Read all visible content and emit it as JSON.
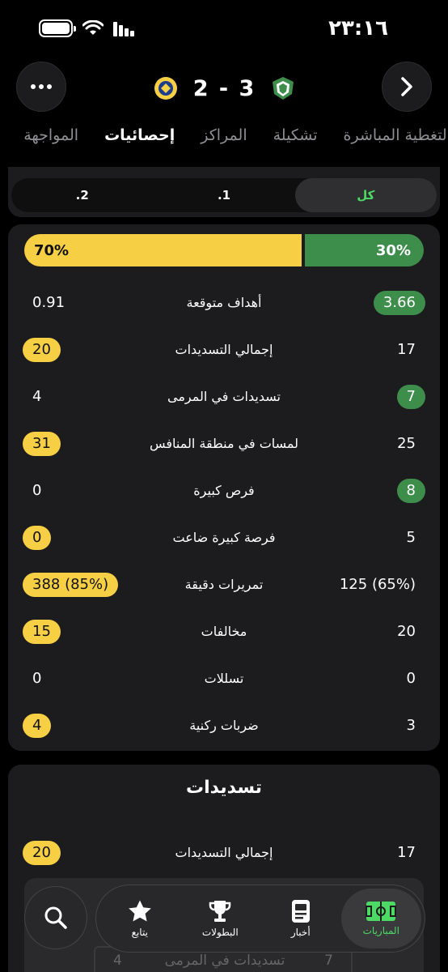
{
  "status": {
    "time": "٢٣:١٦"
  },
  "header": {
    "score": "2 - 3",
    "home_team_color": "#3e8e4b",
    "away_team_color": "#f6cf44"
  },
  "tabs": [
    "التغطية المباشرة",
    "تشكيلة",
    "المراكز",
    "إحصائيات",
    "المواجهة"
  ],
  "active_tab": "إحصائيات",
  "filter": {
    "options": [
      "كل",
      "1.",
      "2."
    ],
    "selected": "كل"
  },
  "possession": {
    "home": "30%",
    "away": "70%",
    "home_fraction": 0.3,
    "away_fraction": 0.7
  },
  "stats": [
    {
      "label": "أهداف متوقعة",
      "home": "3.66",
      "away": "0.91",
      "highlight": "home"
    },
    {
      "label": "إجمالي التسديدات",
      "home": "17",
      "away": "20",
      "highlight": "away"
    },
    {
      "label": "تسديدات في المرمى",
      "home": "7",
      "away": "4",
      "highlight": "home"
    },
    {
      "label": "لمسات في منطقة المنافس",
      "home": "25",
      "away": "31",
      "highlight": "away"
    },
    {
      "label": "فرص كبيرة",
      "home": "8",
      "away": "0",
      "highlight": "home"
    },
    {
      "label": "فرصة كبيرة ضاعت",
      "home": "5",
      "away": "0",
      "highlight": "away"
    },
    {
      "label": "تمريرات دقيقة",
      "home": "125 (65%)",
      "away": "388 (85%)",
      "highlight": "away"
    },
    {
      "label": "مخالفات",
      "home": "20",
      "away": "15",
      "highlight": "away"
    },
    {
      "label": "تسللات",
      "home": "0",
      "away": "0",
      "highlight": "none"
    },
    {
      "label": "ضربات ركنية",
      "home": "3",
      "away": "4",
      "highlight": "away"
    }
  ],
  "shots": {
    "title": "تسديدات",
    "total": {
      "label": "إجمالي التسديدات",
      "home": "17",
      "away": "20"
    },
    "on_target": {
      "label": "تسديدات في المرمى",
      "home": "7",
      "away": "4"
    }
  },
  "bottom_nav": {
    "items": [
      {
        "label": "المباريات",
        "icon": "pitch-icon",
        "active": true
      },
      {
        "label": "أخبار",
        "icon": "news-icon",
        "active": false
      },
      {
        "label": "البطولات",
        "icon": "trophy-icon",
        "active": false
      },
      {
        "label": "يتابع",
        "icon": "star-icon",
        "active": false
      }
    ],
    "search_icon": "search-icon"
  }
}
